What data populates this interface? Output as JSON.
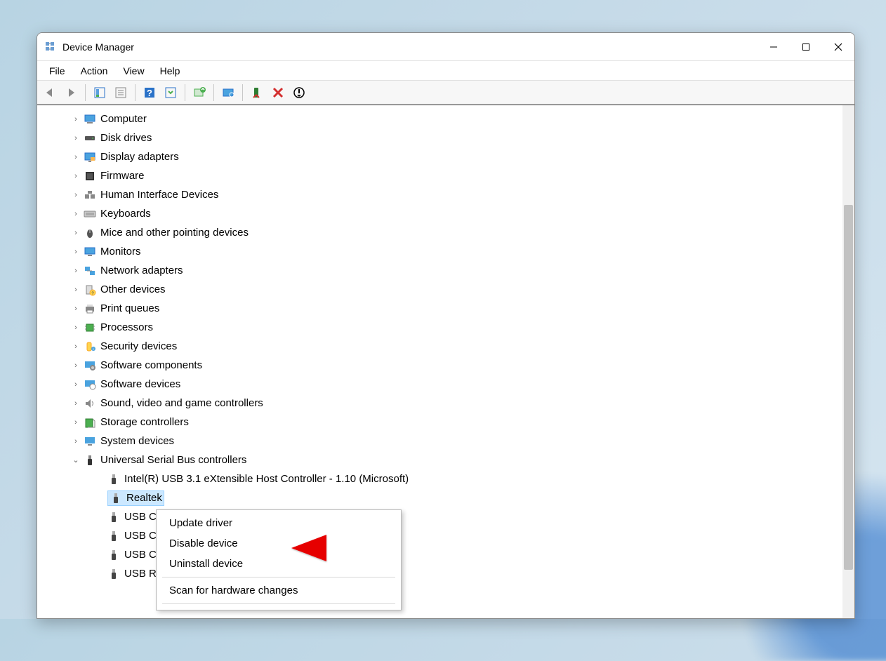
{
  "window": {
    "title": "Device Manager"
  },
  "menu": {
    "file": "File",
    "action": "Action",
    "view": "View",
    "help": "Help"
  },
  "tree": {
    "items": [
      {
        "label": "Computer",
        "expanded": false,
        "icon": "computer"
      },
      {
        "label": "Disk drives",
        "expanded": false,
        "icon": "disk"
      },
      {
        "label": "Display adapters",
        "expanded": false,
        "icon": "display"
      },
      {
        "label": "Firmware",
        "expanded": false,
        "icon": "firmware"
      },
      {
        "label": "Human Interface Devices",
        "expanded": false,
        "icon": "hid"
      },
      {
        "label": "Keyboards",
        "expanded": false,
        "icon": "keyboard"
      },
      {
        "label": "Mice and other pointing devices",
        "expanded": false,
        "icon": "mouse"
      },
      {
        "label": "Monitors",
        "expanded": false,
        "icon": "monitor"
      },
      {
        "label": "Network adapters",
        "expanded": false,
        "icon": "network"
      },
      {
        "label": "Other devices",
        "expanded": false,
        "icon": "other"
      },
      {
        "label": "Print queues",
        "expanded": false,
        "icon": "printer"
      },
      {
        "label": "Processors",
        "expanded": false,
        "icon": "processor"
      },
      {
        "label": "Security devices",
        "expanded": false,
        "icon": "security"
      },
      {
        "label": "Software components",
        "expanded": false,
        "icon": "software-comp"
      },
      {
        "label": "Software devices",
        "expanded": false,
        "icon": "software-dev"
      },
      {
        "label": "Sound, video and game controllers",
        "expanded": false,
        "icon": "sound"
      },
      {
        "label": "Storage controllers",
        "expanded": false,
        "icon": "storage"
      },
      {
        "label": "System devices",
        "expanded": false,
        "icon": "system"
      },
      {
        "label": "Universal Serial Bus controllers",
        "expanded": true,
        "icon": "usb",
        "children": [
          {
            "label": "Intel(R) USB 3.1 eXtensible Host Controller - 1.10 (Microsoft)",
            "icon": "usb-dev"
          },
          {
            "label": "Realtek",
            "icon": "usb-dev",
            "selected": true
          },
          {
            "label": "USB Cc",
            "icon": "usb-dev"
          },
          {
            "label": "USB Cc",
            "icon": "usb-dev"
          },
          {
            "label": "USB Cc",
            "icon": "usb-dev"
          },
          {
            "label": "USB Rc",
            "icon": "usb-dev"
          }
        ]
      }
    ]
  },
  "context_menu": {
    "update": "Update driver",
    "disable": "Disable device",
    "uninstall": "Uninstall device",
    "scan": "Scan for hardware changes"
  }
}
